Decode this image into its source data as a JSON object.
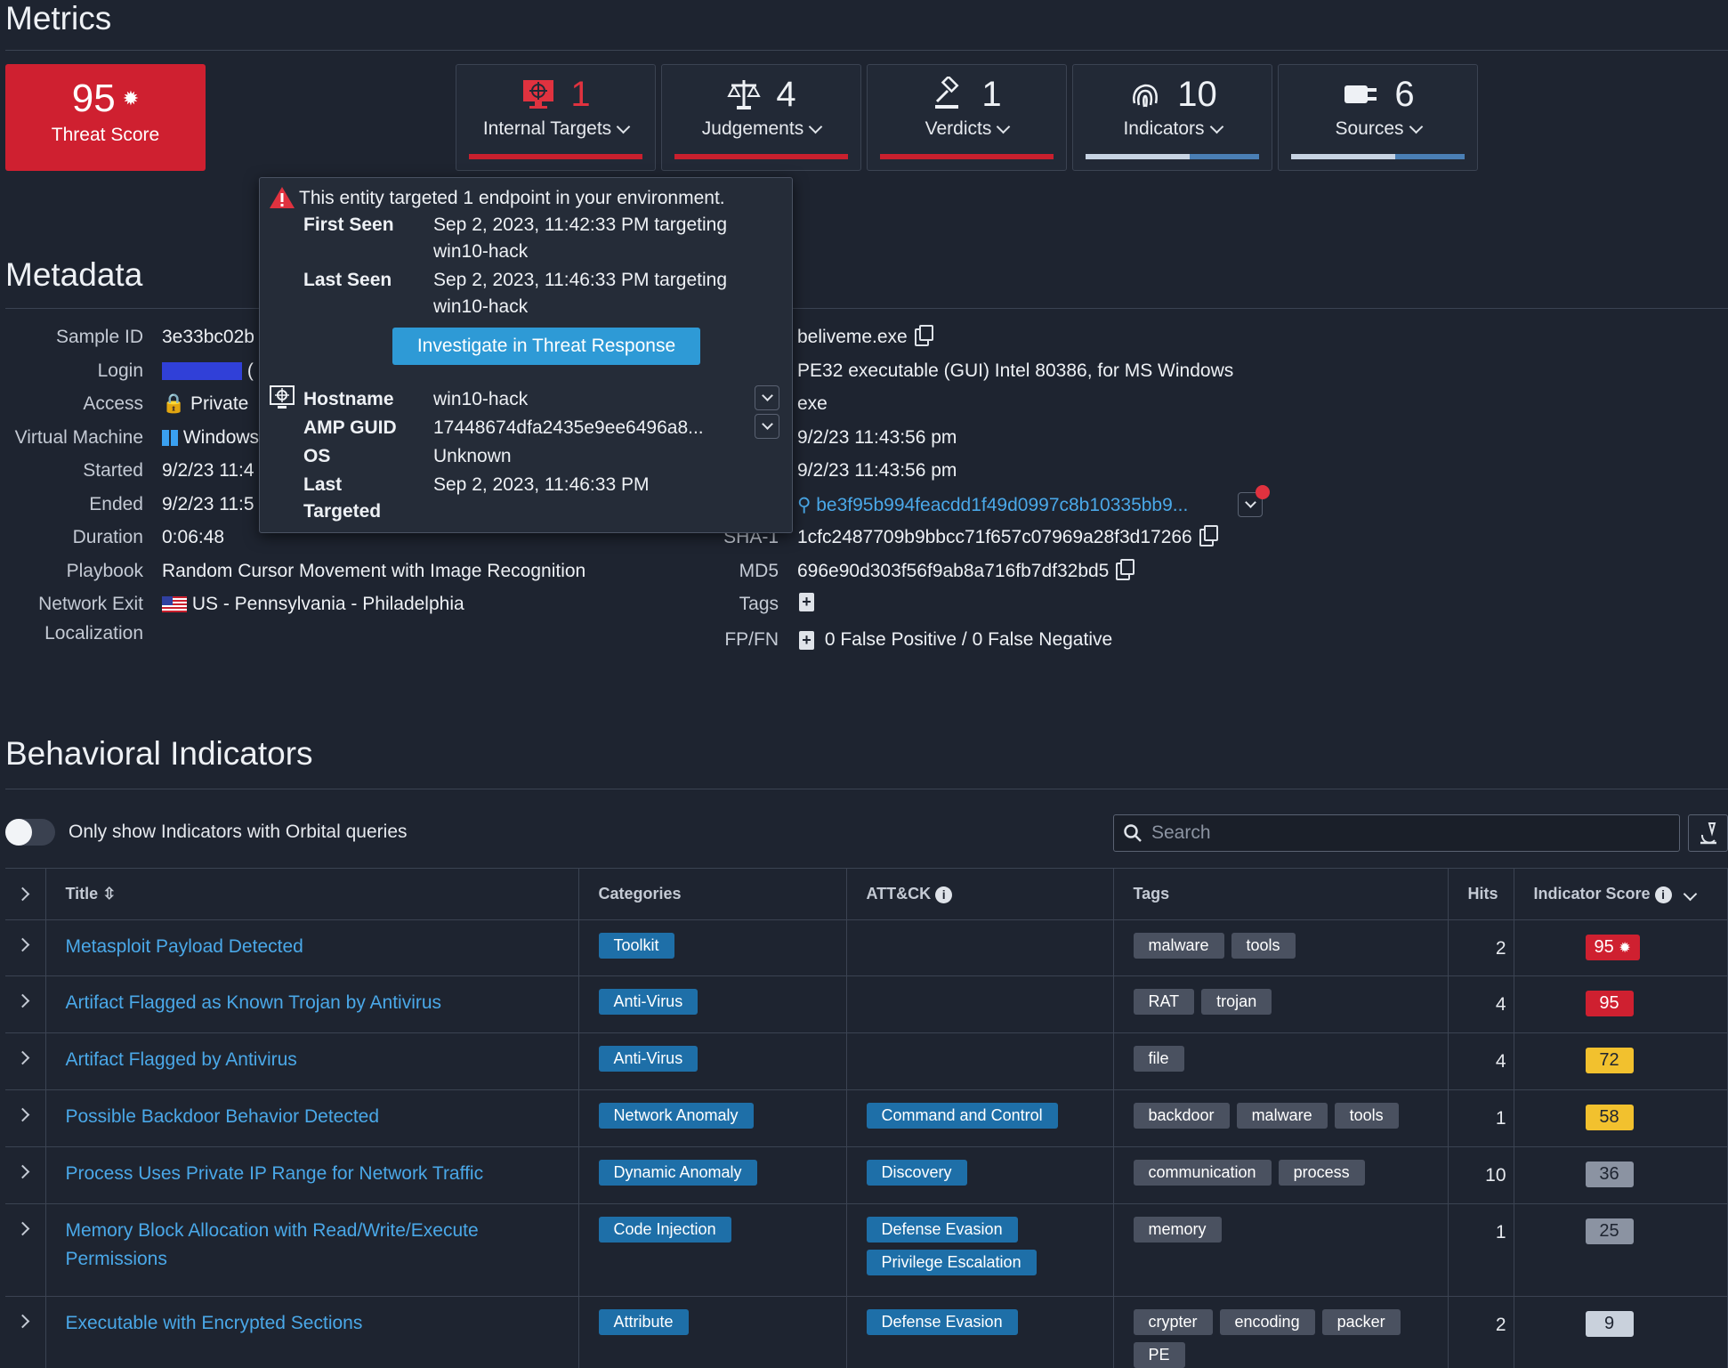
{
  "metrics": {
    "title": "Metrics",
    "threat_score": {
      "value": "95",
      "label": "Threat Score"
    },
    "cards": [
      {
        "count": "1",
        "label": "Internal Targets",
        "icon": "monitor-target-icon"
      },
      {
        "count": "4",
        "label": "Judgements",
        "icon": "scales-icon"
      },
      {
        "count": "1",
        "label": "Verdicts",
        "icon": "gavel-icon"
      },
      {
        "count": "10",
        "label": "Indicators",
        "icon": "fingerprint-icon"
      },
      {
        "count": "6",
        "label": "Sources",
        "icon": "plug-icon"
      }
    ]
  },
  "popover": {
    "heading": "This entity targeted 1 endpoint in your environment.",
    "first_seen_label": "First Seen",
    "first_seen_value": "Sep 2, 2023, 11:42:33 PM targeting",
    "first_seen_target": "win10-hack",
    "last_seen_label": "Last Seen",
    "last_seen_value": "Sep 2, 2023, 11:46:33 PM targeting",
    "last_seen_target": "win10-hack",
    "button": "Investigate in Threat Response",
    "hostname_label": "Hostname",
    "hostname_value": "win10-hack",
    "amp_label": "AMP GUID",
    "amp_value": "17448674dfa2435e9ee6496a8...",
    "os_label": "OS",
    "os_value": "Unknown",
    "last_targeted_label_1": "Last",
    "last_targeted_label_2": "Targeted",
    "last_targeted_value": "Sep 2, 2023, 11:46:33 PM"
  },
  "metadata": {
    "title": "Metadata",
    "left": [
      {
        "label": "Sample ID",
        "value": "3e33bc02b"
      },
      {
        "label": "Login",
        "value": "("
      },
      {
        "label": "Access",
        "value": "Private"
      },
      {
        "label": "Virtual Machine",
        "value": "Windows"
      },
      {
        "label": "Started",
        "value": "9/2/23 11:4"
      },
      {
        "label": "Ended",
        "value": "9/2/23 11:5"
      },
      {
        "label": "Duration",
        "value": "0:06:48"
      },
      {
        "label": "Playbook",
        "value": "Random Cursor Movement with Image Recognition"
      },
      {
        "label": "Network Exit",
        "label2": "Localization",
        "value": "US - Pennsylvania - Philadelphia"
      }
    ],
    "right": {
      "filename": "beliveme.exe",
      "filetype": "PE32 executable (GUI) Intel 80386, for MS Windows",
      "ext": "exe",
      "t1": "9/2/23 11:43:56 pm",
      "t2": "9/2/23 11:43:56 pm",
      "sha256": "be3f95b994feacdd1f49d0997c8b10335bb9...",
      "sha1_label": "SHA-1",
      "sha1": "1cfc2487709b9bbcc71f657c07969a28f3d17266",
      "md5_label": "MD5",
      "md5": "696e90d303f56f9ab8a716fb7df32bd5",
      "tags_label": "Tags",
      "fpfn_label": "FP/FN",
      "fpfn": "0 False Positive / 0 False Negative"
    }
  },
  "behavioral": {
    "title": "Behavioral Indicators",
    "toggle_label": "Only show Indicators with Orbital queries",
    "search_placeholder": "Search",
    "columns": [
      "Title",
      "Categories",
      "ATT&CK",
      "Tags",
      "Hits",
      "Indicator Score"
    ],
    "rows": [
      {
        "title": "Metasploit Payload Detected",
        "categories": [
          "Toolkit"
        ],
        "attack": [],
        "tags": [
          "malware",
          "tools"
        ],
        "hits": "2",
        "score": "95",
        "level": "red",
        "skull": true
      },
      {
        "title": "Artifact Flagged as Known Trojan by Antivirus",
        "categories": [
          "Anti-Virus"
        ],
        "attack": [],
        "tags": [
          "RAT",
          "trojan"
        ],
        "hits": "4",
        "score": "95",
        "level": "red"
      },
      {
        "title": "Artifact Flagged by Antivirus",
        "categories": [
          "Anti-Virus"
        ],
        "attack": [],
        "tags": [
          "file"
        ],
        "hits": "4",
        "score": "72",
        "level": "yellow"
      },
      {
        "title": "Possible Backdoor Behavior Detected",
        "categories": [
          "Network Anomaly"
        ],
        "attack": [
          "Command and Control"
        ],
        "tags": [
          "backdoor",
          "malware",
          "tools"
        ],
        "hits": "1",
        "score": "58",
        "level": "yellow"
      },
      {
        "title": "Process Uses Private IP Range for Network Traffic",
        "categories": [
          "Dynamic Anomaly"
        ],
        "attack": [
          "Discovery"
        ],
        "tags": [
          "communication",
          "process"
        ],
        "hits": "10",
        "score": "36",
        "level": "grey"
      },
      {
        "title": "Memory Block Allocation with Read/Write/Execute Permissions",
        "categories": [
          "Code Injection"
        ],
        "attack": [
          "Defense Evasion",
          "Privilege Escalation"
        ],
        "tags": [
          "memory"
        ],
        "hits": "1",
        "score": "25",
        "level": "grey"
      },
      {
        "title": "Executable with Encrypted Sections",
        "categories": [
          "Attribute"
        ],
        "attack": [
          "Defense Evasion"
        ],
        "tags": [
          "crypter",
          "encoding",
          "packer",
          "PE"
        ],
        "hits": "2",
        "score": "9",
        "level": "light"
      }
    ]
  }
}
